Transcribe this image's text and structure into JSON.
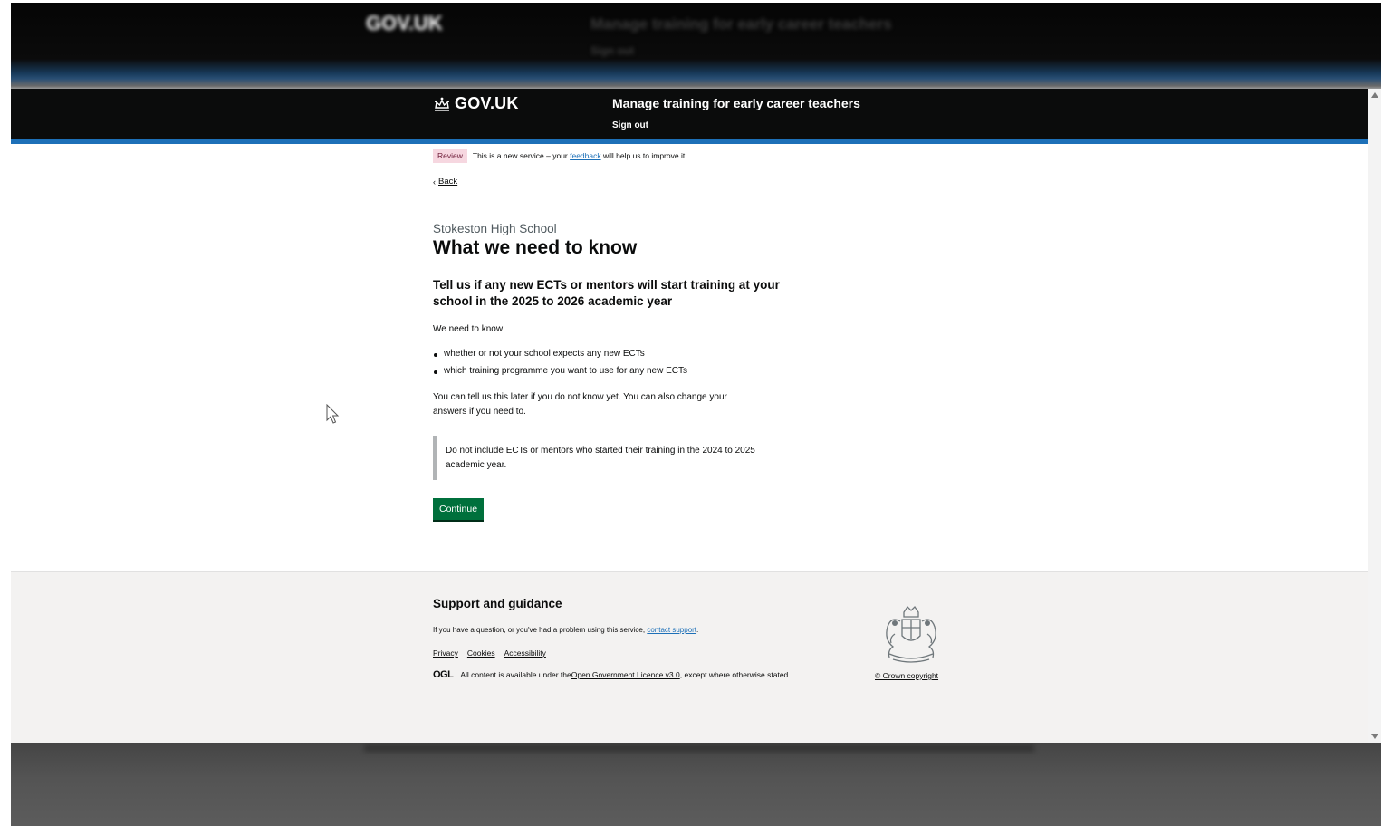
{
  "header": {
    "logo_text": "GOV.UK",
    "service_name": "Manage training for early career teachers",
    "sign_out": "Sign out"
  },
  "phase_banner": {
    "tag": "Review",
    "text_before": "This is a new service – your ",
    "link": "feedback",
    "text_after": " will help us to improve it."
  },
  "back_link": "Back",
  "main": {
    "caption": "Stokeston High School",
    "title": "What we need to know",
    "subheading": "Tell us if any new ECTs or mentors will start training at your school in the 2025 to 2026 academic year",
    "intro": "We need to know:",
    "bullets": [
      "whether or not your school expects any new ECTs",
      "which training programme you want to use for any new ECTs"
    ],
    "later_text": "You can tell us this later if you do not know yet. You can also change your answers if you need to.",
    "inset": "Do not include ECTs or mentors who started their training in the 2024 to 2025 academic year.",
    "continue_button": "Continue"
  },
  "footer": {
    "support_title": "Support and guidance",
    "support_text_before": "If you have a question, or you've had a problem using this service, ",
    "support_link": "contact support",
    "support_text_after": ".",
    "links": [
      "Privacy",
      "Cookies",
      "Accessibility"
    ],
    "ogl": "OGL",
    "licence_before": "All content is available under the ",
    "licence_link": "Open Government Licence v3.0",
    "licence_after": ", except where otherwise stated",
    "copyright": "© Crown copyright"
  },
  "background": {
    "logo_text": "GOV.UK",
    "service_name": "Manage training for early career teachers",
    "sign_out": "Sign out"
  },
  "colors": {
    "header_bg": "#0b0c0c",
    "header_stripe": "#1d70b8",
    "button": "#00703c",
    "link": "#1d70b8",
    "tag_bg": "#f6d7e0",
    "footer_bg": "#f3f2f1"
  }
}
